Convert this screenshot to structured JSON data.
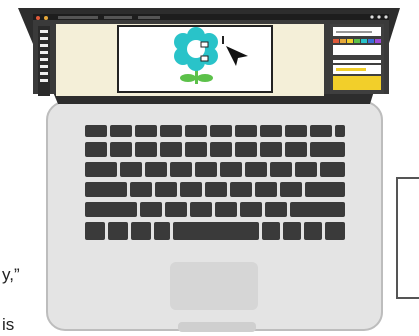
{
  "illustration": {
    "subject": "laptop-top-down",
    "colors": {
      "laptop_body": "#e4e4e4",
      "laptop_outline": "#bdbdbd",
      "screen_bezel": "#2d2d2d",
      "screen_bg": "#f4efd8",
      "keys": "#3a3a3a",
      "flower_petals": "#29c3c9",
      "flower_center": "#ffffff",
      "stem": "#5cc14a",
      "panel_yellow": "#f2cf2a",
      "panel_bg": "#ffffff",
      "touchpad": "#d6d6d6",
      "dot_red": "#e05a3a",
      "dot_yellow": "#e6a83a"
    },
    "icons": [
      "cursor-arrow-icon",
      "selection-handle-icon"
    ]
  },
  "text_fragments": {
    "line_1": "y,”",
    "line_2": "is"
  }
}
